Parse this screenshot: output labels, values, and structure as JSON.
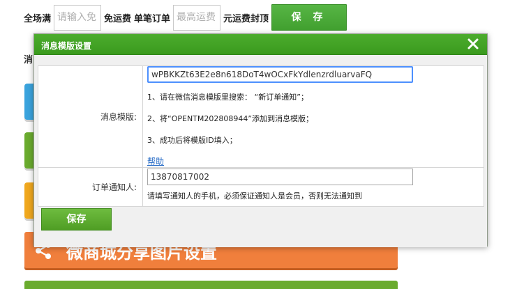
{
  "background": {
    "top_bar": {
      "full_label": "全场满",
      "full_placeholder": "请输入免",
      "free_shipping_label": "免运费",
      "single_order_label": "单笔订单",
      "max_fee_placeholder": "最高运费",
      "cap_label": "元运费封顶",
      "save_label": "保 存"
    },
    "section_label_fragment": "消",
    "share_tile": {
      "label": "微商城分享图片设置",
      "icon": "share-icon"
    },
    "tile_colors": [
      "#3aa3dd",
      "#6aab2e",
      "#f0a81e",
      "#f07f3c",
      "#6aab2e"
    ]
  },
  "dialog": {
    "title": "消息模版设置",
    "close_icon": "close-icon",
    "accent_color": "#41a02f",
    "template_row": {
      "label": "消息模版:",
      "value": "wPBKKZt63E2e8n618DoT4wOCxFkYdlenzrdluarvaFQ",
      "steps": [
        "1、请在微信消息模版里搜索： “新订单通知”；",
        "2、将“OPENTM202808944”添加到消息模版；",
        "3、成功后将模版ID填入；"
      ],
      "help_link": "帮助"
    },
    "notify_row": {
      "label": "订单通知人:",
      "value": "13870817002",
      "hint": "请填写通知人的手机，必须保证通知人是会员，否则无法通知到"
    },
    "save_label": "保存"
  }
}
